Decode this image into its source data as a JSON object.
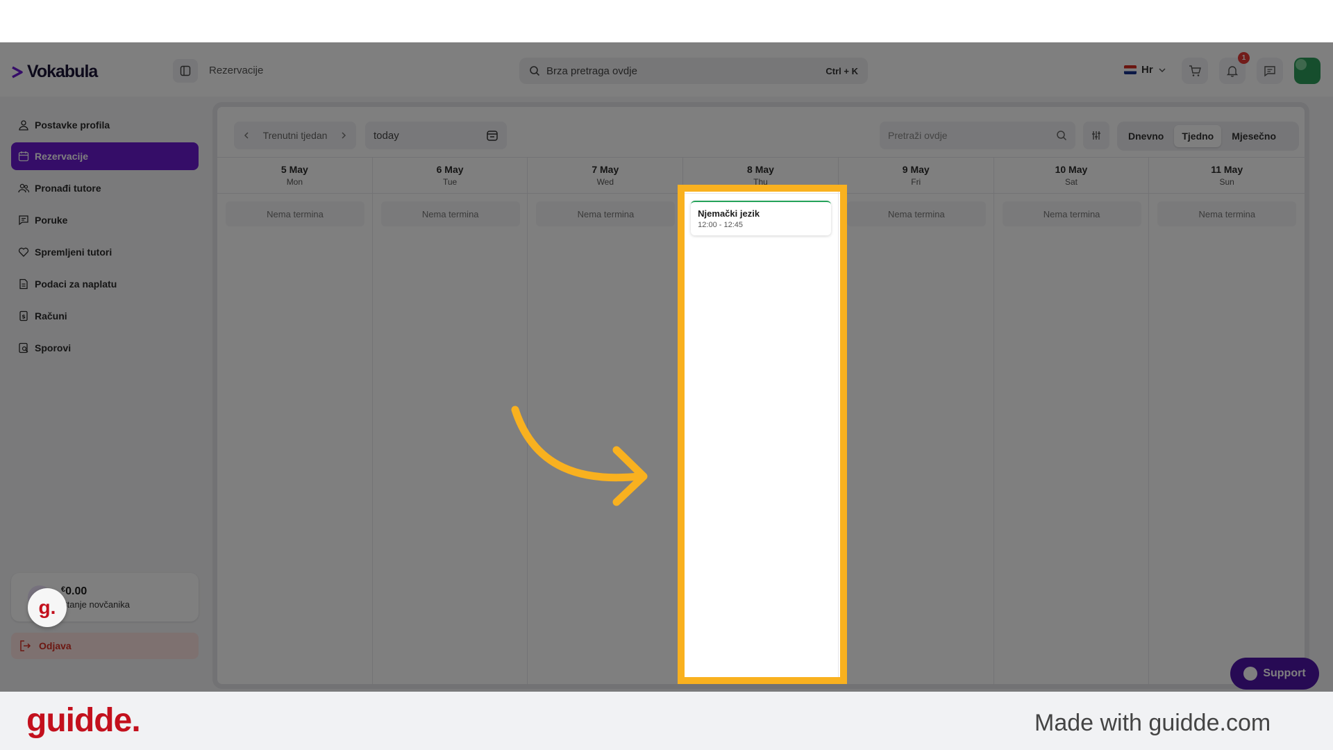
{
  "header": {
    "logo_text": "Vokabula",
    "breadcrumb": "Rezervacije",
    "search_placeholder": "Brza pretraga ovdje",
    "search_shortcut": "Ctrl + K",
    "language": "Hr",
    "notification_count": "1"
  },
  "sidebar": {
    "items": [
      {
        "label": "Postavke profila",
        "icon": "user-icon"
      },
      {
        "label": "Rezervacije",
        "icon": "calendar-icon",
        "active": true
      },
      {
        "label": "Pronađi tutore",
        "icon": "users-icon"
      },
      {
        "label": "Poruke",
        "icon": "message-icon"
      },
      {
        "label": "Spremljeni tutori",
        "icon": "heart-icon"
      },
      {
        "label": "Podaci za naplatu",
        "icon": "billing-icon"
      },
      {
        "label": "Računi",
        "icon": "invoice-icon"
      },
      {
        "label": "Sporovi",
        "icon": "dispute-icon"
      }
    ],
    "wallet": {
      "currency": "€",
      "amount": "0.00",
      "label": "Stanje novčanika"
    },
    "logout_label": "Odjava"
  },
  "calendar": {
    "week_nav_label": "Trenutni tjedan",
    "date_value": "today",
    "search_placeholder": "Pretraži ovdje",
    "views": [
      "Dnevno",
      "Tjedno",
      "Mjesečno"
    ],
    "active_view": "Tjedno",
    "empty_label": "Nema termina",
    "days": [
      {
        "date": "5 May",
        "name": "Mon"
      },
      {
        "date": "6 May",
        "name": "Tue"
      },
      {
        "date": "7 May",
        "name": "Wed"
      },
      {
        "date": "8 May",
        "name": "Thu"
      },
      {
        "date": "9 May",
        "name": "Fri"
      },
      {
        "date": "10 May",
        "name": "Sat"
      },
      {
        "date": "11 May",
        "name": "Sun"
      }
    ],
    "event": {
      "title": "Njemački jezik",
      "time": "12:00 - 12:45"
    }
  },
  "support_label": "Support",
  "guidde_badge": "g.",
  "footer": {
    "logo": "guidde.",
    "text": "Made with guidde.com"
  },
  "colors": {
    "accent": "#6a1bd1",
    "highlight": "#f9b11f",
    "event_bar": "#25a35a",
    "brand_red": "#c3101d"
  }
}
